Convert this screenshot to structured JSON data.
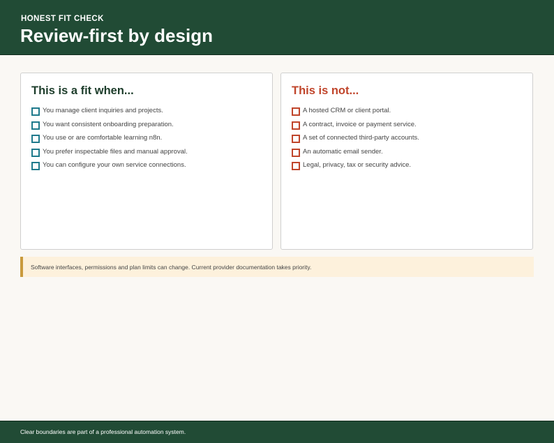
{
  "header": {
    "eyebrow": "HONEST FIT CHECK",
    "title": "Review-first by design"
  },
  "fit_card": {
    "title": "This is a fit when...",
    "items": [
      "You manage client inquiries and projects.",
      "You want consistent onboarding preparation.",
      "You use or are comfortable learning n8n.",
      "You prefer inspectable files and manual approval.",
      "You can configure your own service connections."
    ]
  },
  "not_fit_card": {
    "title": "This is not...",
    "items": [
      "A hosted CRM or client portal.",
      "A contract, invoice or payment service.",
      "A set of connected third-party accounts.",
      "An automatic email sender.",
      "Legal, privacy, tax or security advice."
    ]
  },
  "notice": {
    "text": "Software interfaces, permissions and plan limits can change. Current provider documentation takes priority."
  },
  "footer": {
    "text": "Clear boundaries are part of a professional automation system."
  },
  "colors": {
    "header_bg": "#214b35",
    "fit_accent": "#1f7a8c",
    "not_fit_accent": "#c0452b",
    "notice_bg": "#fdf1dc",
    "notice_border": "#c99a3c"
  }
}
